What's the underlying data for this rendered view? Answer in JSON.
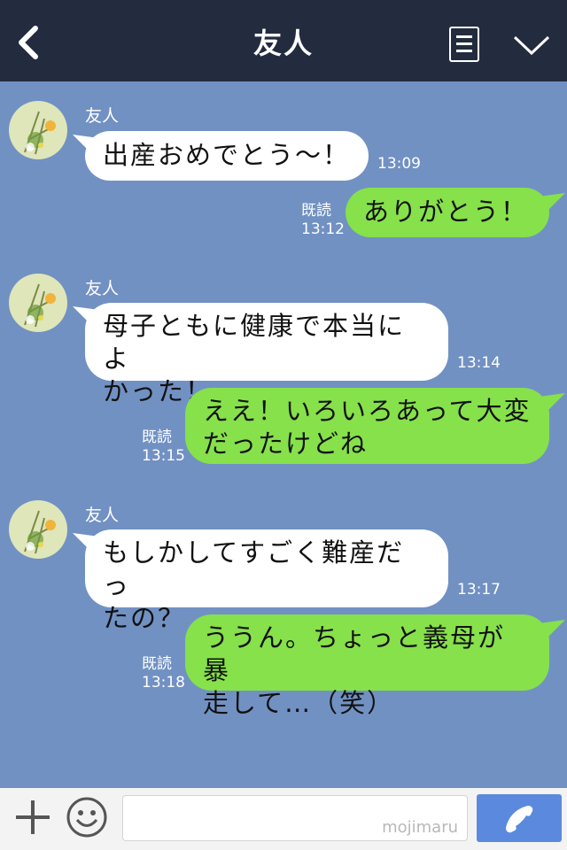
{
  "header": {
    "title": "友人",
    "back_icon": "chevron-left-icon",
    "menu_icon": "menu-list-icon",
    "expand_icon": "chevron-down-icon"
  },
  "messages": [
    {
      "sender_name": "友人",
      "text_lines": [
        "出産おめでとう〜！"
      ],
      "time": "13:09"
    },
    {
      "read": "既読",
      "text_lines": [
        "ありがとう！"
      ],
      "time": "13:12"
    },
    {
      "sender_name": "友人",
      "text_lines": [
        "母子ともに健康で本当によ",
        "かった！"
      ],
      "time": "13:14"
    },
    {
      "read": "既読",
      "text_lines": [
        "ええ！いろいろあって大変",
        "だったけどね"
      ],
      "time": "13:15"
    },
    {
      "sender_name": "友人",
      "text_lines": [
        "もしかしてすごく難産だっ",
        "たの？"
      ],
      "time": "13:17"
    },
    {
      "read": "既読",
      "text_lines": [
        "ううん。ちょっと義母が暴",
        "走して…（笑）"
      ],
      "time": "13:18"
    }
  ],
  "footer": {
    "plus_icon": "plus-icon",
    "emoji_icon": "smiley-icon",
    "input_value": "",
    "watermark": "mojimaru",
    "call_icon": "phone-icon"
  },
  "colors": {
    "background": "#7191c3",
    "header": "#232b3f",
    "incoming": "#ffffff",
    "outgoing": "#86e14b",
    "call": "#5b89dd"
  }
}
